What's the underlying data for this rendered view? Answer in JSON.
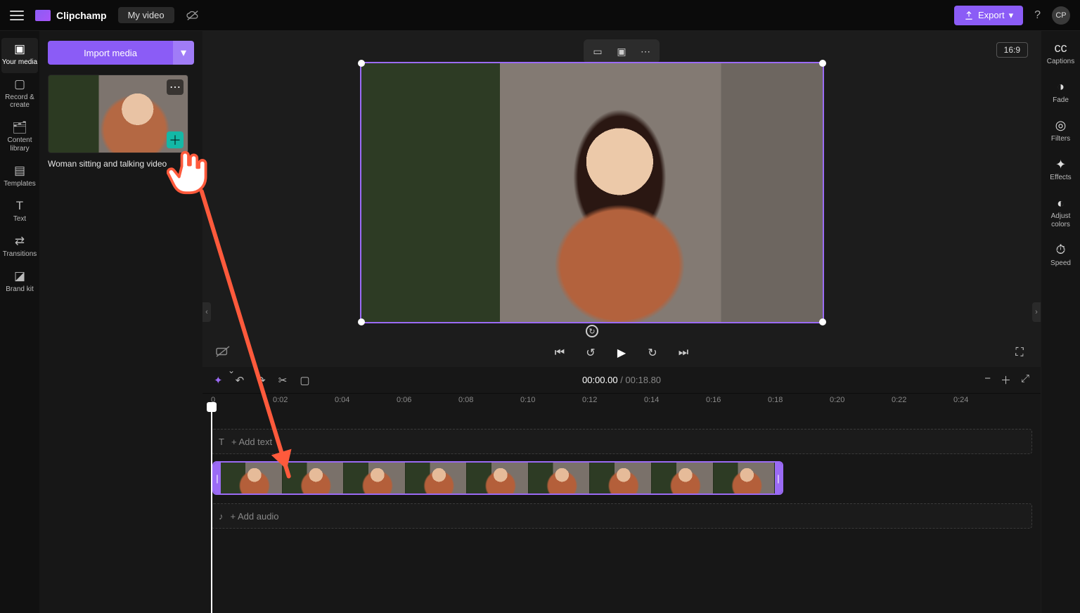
{
  "app": {
    "name": "Clipchamp",
    "project_title": "My video"
  },
  "header": {
    "export_label": "Export",
    "avatar_initials": "CP"
  },
  "left_nav": [
    {
      "id": "your-media",
      "label": "Your media"
    },
    {
      "id": "record-create",
      "label": "Record & create"
    },
    {
      "id": "content-library",
      "label": "Content library"
    },
    {
      "id": "templates",
      "label": "Templates"
    },
    {
      "id": "text",
      "label": "Text"
    },
    {
      "id": "transitions",
      "label": "Transitions"
    },
    {
      "id": "brand-kit",
      "label": "Brand kit"
    }
  ],
  "media": {
    "import_label": "Import media",
    "item_title": "Woman sitting and talking video",
    "add_tooltip": "Add to timeline"
  },
  "right_nav": [
    {
      "id": "captions",
      "label": "Captions"
    },
    {
      "id": "fade",
      "label": "Fade"
    },
    {
      "id": "filters",
      "label": "Filters"
    },
    {
      "id": "effects",
      "label": "Effects"
    },
    {
      "id": "adjust-colors",
      "label": "Adjust colors"
    },
    {
      "id": "speed",
      "label": "Speed"
    }
  ],
  "stage": {
    "aspect_label": "16:9"
  },
  "playback": {
    "current_time": "00:00.00",
    "separator": " / ",
    "total_time": "00:18.80"
  },
  "ruler": [
    "0",
    "0:02",
    "0:04",
    "0:06",
    "0:08",
    "0:10",
    "0:12",
    "0:14",
    "0:16",
    "0:18",
    "0:20",
    "0:22",
    "0:24"
  ],
  "tracks": {
    "add_text_label": "+ Add text",
    "add_audio_label": "+ Add audio"
  },
  "colors": {
    "accent": "#8b5cf6",
    "teal": "#14b8a6",
    "annotation": "#ff5a3c"
  }
}
